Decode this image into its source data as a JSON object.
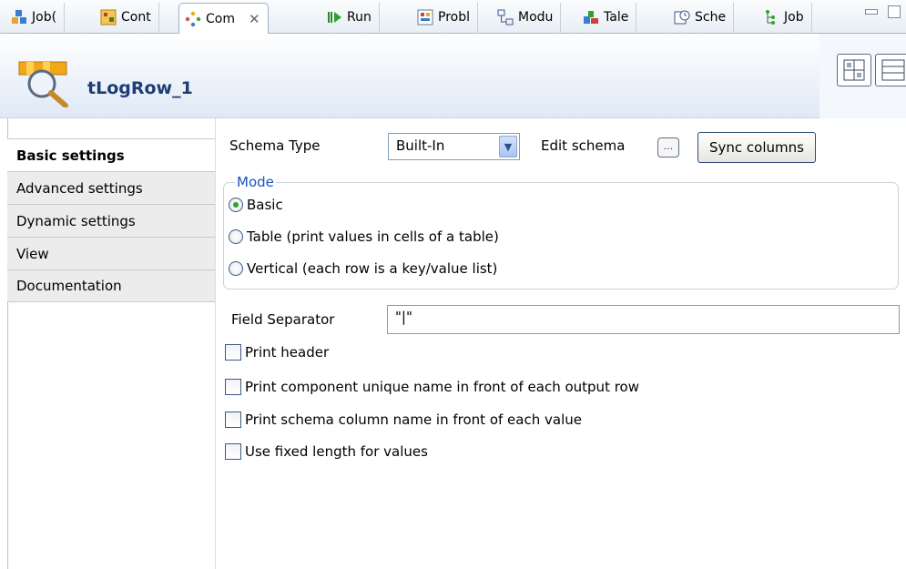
{
  "tabs": [
    {
      "label": "Job(",
      "icon": "job-icon"
    },
    {
      "label": "Cont",
      "icon": "contexts-icon"
    },
    {
      "label": "Com",
      "icon": "component-icon"
    },
    {
      "label": "Run",
      "icon": "run-icon"
    },
    {
      "label": "Probl",
      "icon": "problems-icon"
    },
    {
      "label": "Modu",
      "icon": "modules-icon"
    },
    {
      "label": "Tale",
      "icon": "talend-exchange-icon"
    },
    {
      "label": "Sche",
      "icon": "scheduler-icon"
    },
    {
      "label": "Job",
      "icon": "job-hierarchy-icon"
    }
  ],
  "component": {
    "title": "tLogRow_1",
    "icon": "tlogrow-icon"
  },
  "side_tabs": [
    {
      "label": "Basic settings"
    },
    {
      "label": "Advanced settings"
    },
    {
      "label": "Dynamic settings"
    },
    {
      "label": "View"
    },
    {
      "label": "Documentation"
    }
  ],
  "schema": {
    "type_label": "Schema Type",
    "type_value": "Built-In",
    "edit_label": "Edit schema",
    "edit_button": "...",
    "sync_button": "Sync columns"
  },
  "mode": {
    "legend": "Mode",
    "options": [
      {
        "label": "Basic",
        "selected": true
      },
      {
        "label": "Table (print values in cells of a table)",
        "selected": false
      },
      {
        "label": "Vertical (each row is a key/value list)",
        "selected": false
      }
    ]
  },
  "field_separator": {
    "label": "Field Separator",
    "value": "\"|\""
  },
  "checkboxes": [
    {
      "label": "Print header",
      "checked": false
    },
    {
      "label": "Print component unique name in front of each output row",
      "checked": false
    },
    {
      "label": "Print schema column name in front of each value",
      "checked": false
    },
    {
      "label": "Use fixed length for values",
      "checked": false
    }
  ],
  "colors": {
    "title": "#1e3d73",
    "legend": "#1a52c9",
    "radio_dot": "#2fa12f"
  }
}
